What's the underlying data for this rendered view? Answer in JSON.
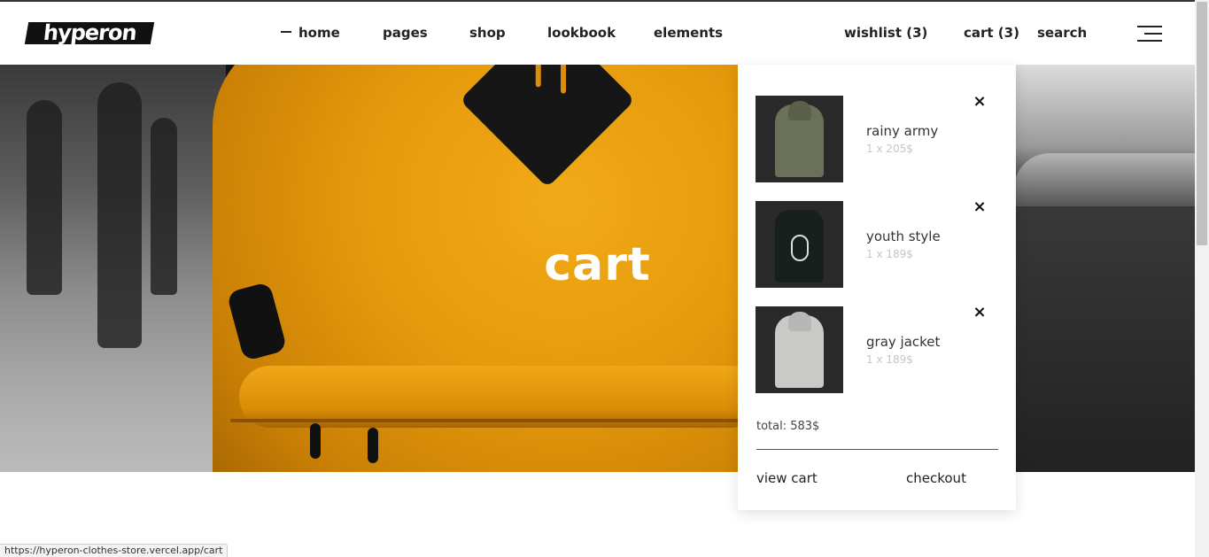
{
  "brand": {
    "logo_text": "hyperon"
  },
  "nav": {
    "items": [
      {
        "label": "home",
        "active": true
      },
      {
        "label": "pages"
      },
      {
        "label": "shop"
      },
      {
        "label": "lookbook"
      },
      {
        "label": "elements"
      }
    ],
    "right": {
      "wishlist": "wishlist (3)",
      "cart": "cart (3)",
      "search": "search"
    },
    "menu_icon": "hamburger-icon"
  },
  "hero": {
    "title": "cart"
  },
  "cart_dropdown": {
    "items": [
      {
        "name": "rainy army",
        "price": "1 x 205$",
        "thumb_color": "#6b7058",
        "remove_icon": "close-icon"
      },
      {
        "name": "youth style",
        "price": "1 x 189$",
        "thumb_color": "#18201d",
        "remove_icon": "close-icon"
      },
      {
        "name": "gray jacket",
        "price": "1 x 189$",
        "thumb_color": "#c9cac8",
        "remove_icon": "close-icon"
      }
    ],
    "remove_glyph": "×",
    "total": "total: 583$",
    "view_cart": "view cart",
    "checkout": "checkout"
  },
  "status_bar": {
    "url": "https://hyperon-clothes-store.vercel.app/cart"
  },
  "colors": {
    "accent": "#e59a0c",
    "text": "#222222",
    "muted": "#c6c6c6"
  }
}
